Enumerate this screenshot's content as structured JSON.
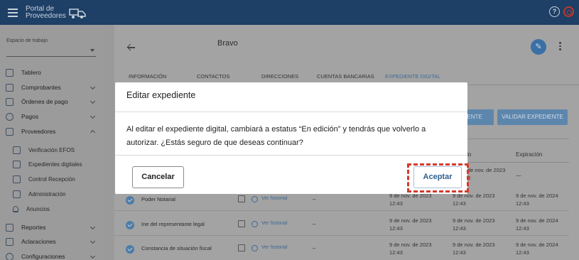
{
  "app": {
    "logo_line1": "Portal de",
    "logo_line2": "Proveedores",
    "help_glyph": "?"
  },
  "sidebar": {
    "workspace_label": "Espacio de trabajo",
    "workspace_value": "",
    "items": [
      {
        "label": "Tablero",
        "icon": "dashboard-icon"
      },
      {
        "label": "Comprobantes",
        "icon": "file-icon"
      },
      {
        "label": "Órdenes de pago",
        "icon": "card-icon"
      },
      {
        "label": "Pagos",
        "icon": "dollar-icon"
      },
      {
        "label": "Proveedores",
        "icon": "building-icon"
      },
      {
        "label": "Verificación EFOS",
        "icon": "verify-icon"
      },
      {
        "label": "Expedientes digitales",
        "icon": "folder-icon"
      },
      {
        "label": "Control Recepción",
        "icon": "list-icon"
      },
      {
        "label": "Administración",
        "icon": "admin-icon"
      },
      {
        "label": "Anuncios",
        "icon": "bell-icon"
      },
      {
        "label": "Reportes",
        "icon": "chart-icon"
      },
      {
        "label": "Aclaraciones",
        "icon": "mail-icon"
      },
      {
        "label": "Configuraciones",
        "icon": "gear-icon"
      }
    ]
  },
  "main": {
    "title": "Bravo",
    "edit_glyph": "✎",
    "tabs": [
      "INFORMACIÓN",
      "CONTACTOS",
      "DIRECCIONES",
      "CUENTAS BANCARIAS",
      "EXPEDIENTE DIGITAL"
    ],
    "button_partial": "IENTE",
    "validate_button": "VALIDAR EXPEDIENTE",
    "col_header_partial": "ado",
    "col_expiration": "Expiración",
    "first_row_frag": {
      "d2": "de nov. de 2023",
      "d2b": "3",
      "d3": "—"
    },
    "rows": [
      {
        "name": "Poder Notarial",
        "history": "Ver historial",
        "status": "–",
        "d1": "9 de nov. de 2023",
        "d1t": "12:43",
        "d2": "9 de nov. de 2023",
        "d2t": "12:43",
        "d3": "9 de nov. de 2024",
        "d3t": "12:43"
      },
      {
        "name": "Ine del representante legal",
        "history": "Ver historial",
        "status": "–",
        "d1": "9 de nov. de 2023",
        "d1t": "12:43",
        "d2": "9 de nov. de 2023",
        "d2t": "12:43",
        "d3": "9 de nov. de 2024",
        "d3t": "12:43"
      },
      {
        "name": "Constancia de situación fiscal",
        "history": "Ver historial",
        "status": "–",
        "d1": "9 de nov. de 2023",
        "d1t": "12:43",
        "d2": "9 de nov. de 2023",
        "d2t": "12:43",
        "d3": "9 de nov. de 2024",
        "d3t": "12:43"
      }
    ]
  },
  "modal": {
    "title": "Editar expediente",
    "body": "Al editar el expediente digital, cambiará a estatus “En edición” y tendrás que volverlo a autorizar. ¿Estás seguro de que deseas continuar?",
    "cancel": "Cancelar",
    "accept": "Aceptar",
    "highlight_color": "#d23a2e"
  }
}
